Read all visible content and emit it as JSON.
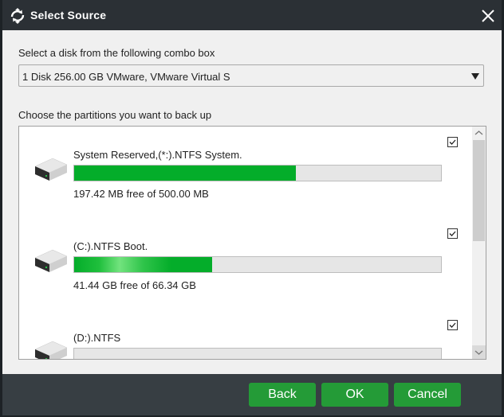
{
  "dialog": {
    "title": "Select Source",
    "title_icon": "sync-arrows-icon",
    "close_icon": "close-icon"
  },
  "disk_select": {
    "label": "Select a disk from the following combo box",
    "value": "1 Disk 256.00 GB VMware,  VMware Virtual S"
  },
  "partitions": {
    "label": "Choose the partitions you want to back up",
    "items": [
      {
        "name": "System Reserved,(*:).NTFS System.",
        "free_text": "197.42 MB free of 500.00 MB",
        "used_fraction": 0.605,
        "checked": true
      },
      {
        "name": "(C:).NTFS Boot.",
        "free_text": "41.44 GB free of 66.34 GB",
        "used_fraction": 0.375,
        "checked": true
      },
      {
        "name": "(D:).NTFS",
        "free_text": "",
        "used_fraction": 0,
        "checked": true
      }
    ]
  },
  "buttons": {
    "back": "Back",
    "ok": "OK",
    "cancel": "Cancel"
  },
  "colors": {
    "accent_green": "#249b37",
    "bar_fill": "#04ad2a",
    "titlebar": "#2b3035",
    "footer": "#373e43"
  }
}
